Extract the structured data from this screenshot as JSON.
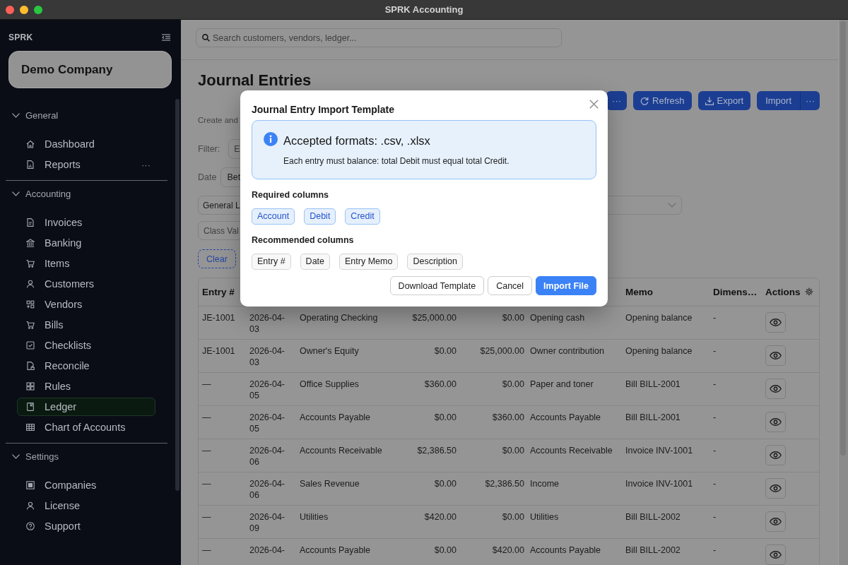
{
  "window": {
    "title": "SPRK Accounting"
  },
  "sidebar": {
    "brand": "SPRK",
    "company": "Demo Company",
    "sections": [
      {
        "title": "General",
        "expanded": true,
        "items": [
          {
            "label": "Dashboard",
            "selected": false
          },
          {
            "label": "Reports",
            "selected": false,
            "more": "···"
          }
        ]
      },
      {
        "title": "Accounting",
        "expanded": true,
        "items": [
          {
            "label": "Invoices",
            "selected": false
          },
          {
            "label": "Banking",
            "selected": false
          },
          {
            "label": "Items",
            "selected": false
          },
          {
            "label": "Customers",
            "selected": false
          },
          {
            "label": "Vendors",
            "selected": false
          },
          {
            "label": "Bills",
            "selected": false
          },
          {
            "label": "Checklists",
            "selected": false
          },
          {
            "label": "Reconcile",
            "selected": false
          },
          {
            "label": "Rules",
            "selected": false
          },
          {
            "label": "Ledger",
            "selected": true
          },
          {
            "label": "Chart of Accounts",
            "selected": false
          }
        ]
      },
      {
        "title": "Settings",
        "expanded": true,
        "items": [
          {
            "label": "Companies",
            "selected": false
          },
          {
            "label": "License",
            "selected": false
          },
          {
            "label": "Support",
            "selected": false
          }
        ]
      }
    ]
  },
  "search": {
    "placeholder": "Search customers, vendors, ledger..."
  },
  "page": {
    "title": "Journal Entries",
    "subtitle": "Create and",
    "toolbar": [
      {
        "kind": "more",
        "label": "···"
      },
      {
        "kind": "button",
        "label": "Refresh"
      },
      {
        "kind": "button",
        "label": "Export"
      },
      {
        "kind": "split",
        "label": "Import",
        "more": "···"
      }
    ]
  },
  "filters": {
    "filter_label": "Filter:",
    "filter_placeholder": "E",
    "date_label": "Date",
    "date_value": "Bet",
    "ledger_value": "General L",
    "class_placeholder": "Class Val",
    "clear_button": "Clear"
  },
  "table": {
    "columns": [
      {
        "label": "Entry #"
      },
      {},
      {},
      {},
      {},
      {},
      {
        "label": "Memo"
      },
      {
        "label": "Dimens…"
      },
      {
        "label": "Actions"
      }
    ],
    "rows": [
      [
        "JE-1001",
        "2026-04-03",
        "Operating Checking",
        "$25,000.00",
        "$0.00",
        "Opening cash",
        "Opening balance",
        "-"
      ],
      [
        "JE-1001",
        "2026-04-03",
        "Owner's Equity",
        "$0.00",
        "$25,000.00",
        "Owner contribution",
        "Opening balance",
        "-"
      ],
      [
        "—",
        "2026-04-05",
        "Office Supplies",
        "$360.00",
        "$0.00",
        "Paper and toner",
        "Bill BILL-2001",
        "-"
      ],
      [
        "—",
        "2026-04-05",
        "Accounts Payable",
        "$0.00",
        "$360.00",
        "Accounts Payable",
        "Bill BILL-2001",
        "-"
      ],
      [
        "—",
        "2026-04-06",
        "Accounts Receivable",
        "$2,386.50",
        "$0.00",
        "Accounts Receivable",
        "Invoice INV-1001",
        "-"
      ],
      [
        "—",
        "2026-04-06",
        "Sales Revenue",
        "$0.00",
        "$2,386.50",
        "Income",
        "Invoice INV-1001",
        "-"
      ],
      [
        "—",
        "2026-04-09",
        "Utilities",
        "$420.00",
        "$0.00",
        "Utilities",
        "Bill BILL-2002",
        "-"
      ],
      [
        "—",
        "2026-04-",
        "Accounts Payable",
        "$0.00",
        "$420.00",
        "Accounts Payable",
        "Bill BILL-2002",
        "-"
      ]
    ]
  },
  "dialog": {
    "title": "Journal Entry Import Template",
    "info": {
      "heading": "Accepted formats: .csv, .xlsx",
      "text": "Each entry must balance: total Debit must equal total Credit."
    },
    "required_title": "Required columns",
    "required": [
      "Account",
      "Debit",
      "Credit"
    ],
    "recommended_title": "Recommended columns",
    "recommended": [
      "Entry #",
      "Date",
      "Entry Memo",
      "Description"
    ],
    "buttons": [
      {
        "label": "Download Template",
        "kind": "secondary"
      },
      {
        "label": "Cancel",
        "kind": "secondary"
      },
      {
        "label": "Import File",
        "kind": "primary"
      }
    ]
  }
}
